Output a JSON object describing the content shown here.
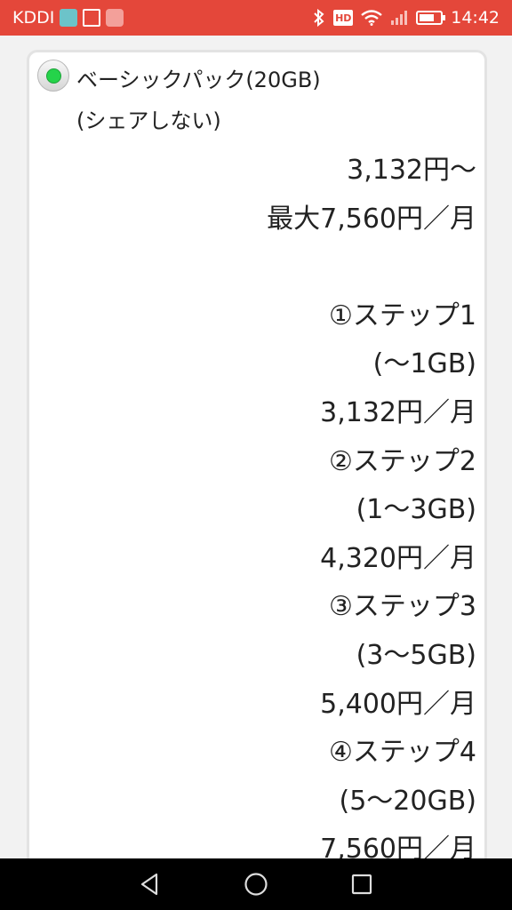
{
  "status_bar": {
    "carrier": "KDDI",
    "time": "14:42",
    "hd_badge": "HD"
  },
  "plan_option": {
    "selected": true,
    "title_line1": "ベーシックパック(20GB)",
    "title_line2": "(シェアしない)",
    "price_from": "3,132円〜",
    "price_max": "最大7,560円／月",
    "steps": [
      {
        "label": "①ステップ1",
        "range": "(〜1GB)",
        "price": "3,132円／月"
      },
      {
        "label": "②ステップ2",
        "range": "(1〜3GB)",
        "price": "4,320円／月"
      },
      {
        "label": "③ステップ3",
        "range": "(3〜5GB)",
        "price": "5,400円／月"
      },
      {
        "label": "④ステップ4",
        "range": "(5〜20GB)",
        "price": "7,560円／月"
      }
    ]
  },
  "colors": {
    "status_bar": "#e4473a",
    "radio_selected": "#25d34a"
  },
  "icons": {
    "nav_back": "back-triangle-icon",
    "nav_home": "home-circle-icon",
    "nav_recents": "recents-square-icon"
  }
}
